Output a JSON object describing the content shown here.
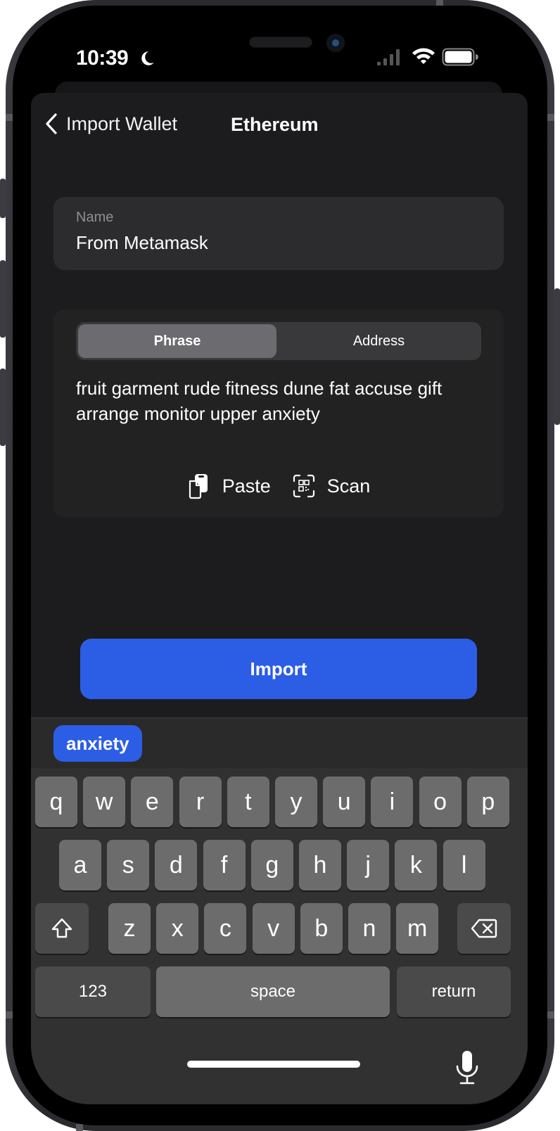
{
  "status_bar": {
    "time": "10:39",
    "focus_icon": "moon-icon",
    "signal_icon": "cellular-signal-icon",
    "wifi_icon": "wifi-icon",
    "battery_icon": "battery-icon"
  },
  "nav": {
    "back_label": "Import Wallet",
    "title": "Ethereum"
  },
  "name_field": {
    "label": "Name",
    "value": "From Metamask"
  },
  "segmented_control": {
    "options": [
      {
        "label": "Phrase",
        "selected": true
      },
      {
        "label": "Address",
        "selected": false
      }
    ]
  },
  "phrase": {
    "text": "fruit garment rude fitness dune fat accuse gift arrange monitor upper anxiety"
  },
  "actions": {
    "paste_label": "Paste",
    "paste_icon": "clipboard-icon",
    "scan_label": "Scan",
    "scan_icon": "qr-scan-icon"
  },
  "import_button": {
    "label": "Import"
  },
  "keyboard": {
    "suggestion": "anxiety",
    "row1": [
      "q",
      "w",
      "e",
      "r",
      "t",
      "y",
      "u",
      "i",
      "o",
      "p"
    ],
    "row2": [
      "a",
      "s",
      "d",
      "f",
      "g",
      "h",
      "j",
      "k",
      "l"
    ],
    "row3": [
      "z",
      "x",
      "c",
      "v",
      "b",
      "n",
      "m"
    ],
    "numbers_label": "123",
    "space_label": "space",
    "return_label": "return",
    "shift_icon": "shift-icon",
    "delete_icon": "backspace-icon",
    "mic_icon": "microphone-icon"
  },
  "colors": {
    "accent": "#2c5de5",
    "sheet_background": "#1c1c1e",
    "card_background": "#2c2c2e",
    "key_background": "#6c6c6c",
    "keyboard_background": "#313131"
  }
}
